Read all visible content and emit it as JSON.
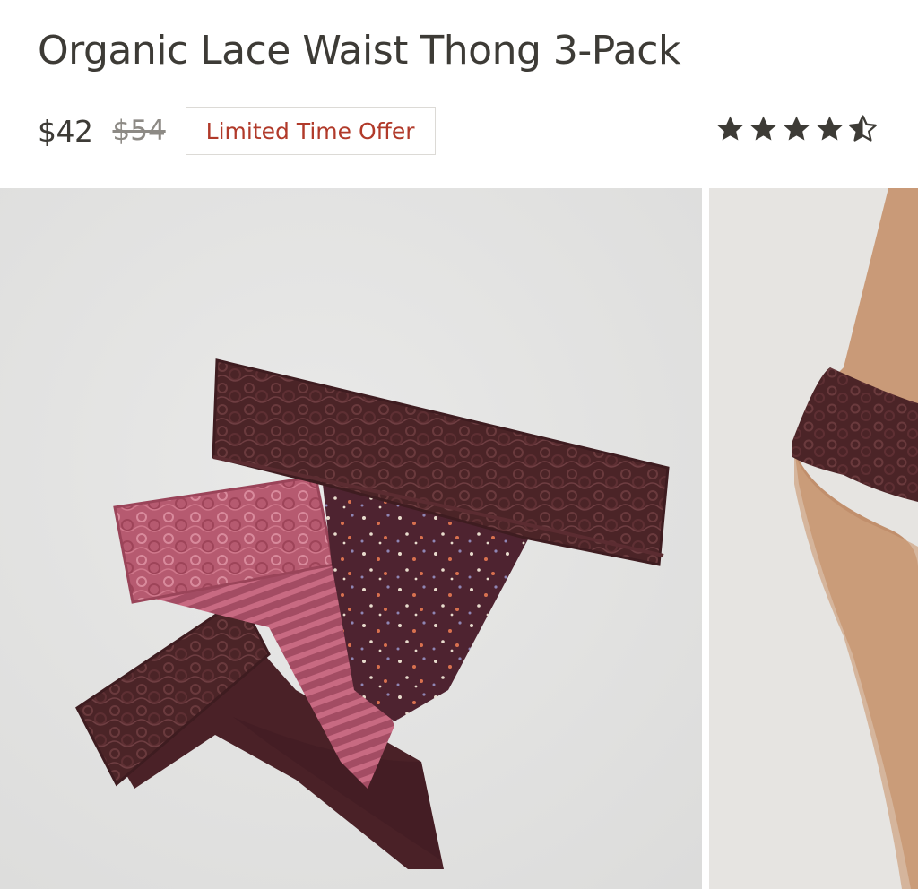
{
  "product": {
    "title": "Organic Lace Waist Thong 3-Pack",
    "price": "$42",
    "compare_price": "$54",
    "badge": "Limited Time Offer",
    "rating": 4.5,
    "rating_icons": [
      "star-full",
      "star-full",
      "star-full",
      "star-full",
      "star-half"
    ]
  },
  "colors": {
    "text": "#3d3b36",
    "sale_badge": "#b13a2a",
    "compare_price": "#8d8a85",
    "lace_dark": "#4a2427",
    "lace_pink": "#b75c72",
    "print_base": "#4f2430",
    "skin": "#c99a78"
  },
  "gallery": {
    "images": [
      {
        "alt": "flat-lay-three-thongs-icon"
      },
      {
        "alt": "model-wearing-lace-thong-icon"
      }
    ]
  }
}
